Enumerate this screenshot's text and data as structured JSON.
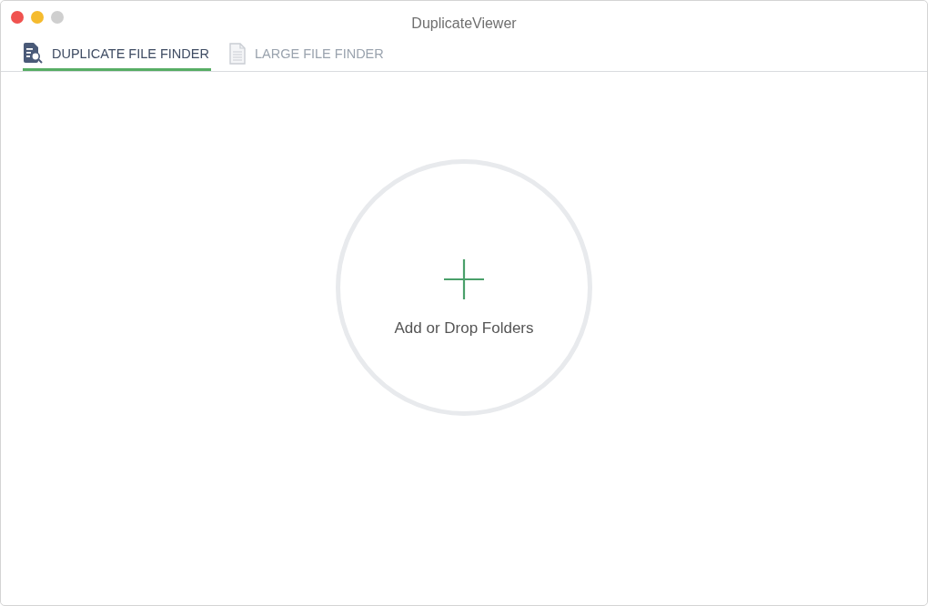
{
  "window": {
    "title": "DuplicateViewer"
  },
  "tabs": [
    {
      "label": "DUPLICATE FILE FINDER",
      "kind": "duplicate",
      "selected": true
    },
    {
      "label": "LARGE FILE FINDER",
      "kind": "large",
      "selected": false
    }
  ],
  "drop_zone": {
    "label": "Add or Drop Folders"
  }
}
